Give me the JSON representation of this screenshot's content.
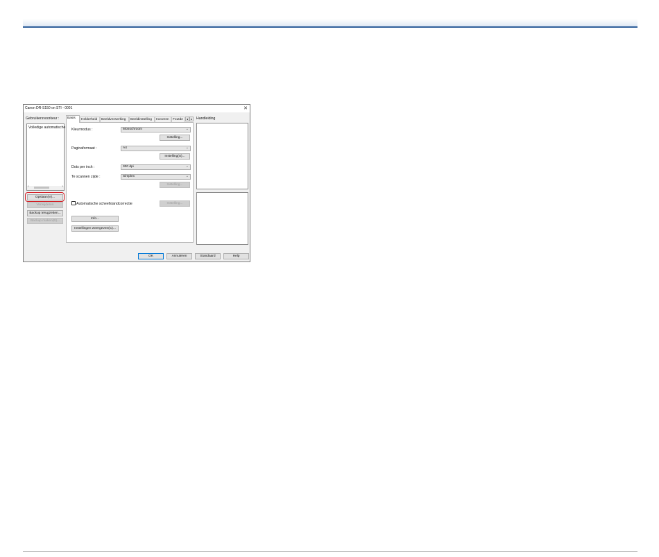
{
  "dialog": {
    "title": "Canon DR-S150 on STI - 0001",
    "close_glyph": "✕"
  },
  "user_settings": {
    "label": "Gebruikersvoorkeur :",
    "items": [
      "Volledige automatische"
    ],
    "buttons": {
      "update": "Opslaan(V)...",
      "delete": "Verwijderen",
      "restore": "Backup terugzetten...",
      "backup": "Backup maken(B)..."
    }
  },
  "tabs": [
    "Basis",
    "Helderheid",
    "Beeldverwerking",
    "Beeldinstelling",
    "Invoeren",
    "Foutde"
  ],
  "tab_arrows": {
    "left": "◂",
    "right": "▸"
  },
  "basic": {
    "color_mode": {
      "label": "Kleurmodus :",
      "value": "Monochroom"
    },
    "color_settings_button": "Instelling...",
    "page_size": {
      "label": "Paginaformaat :",
      "value": "A4"
    },
    "page_settings_button": "Instelling(S)...",
    "dpi": {
      "label": "Dots per inch :",
      "value": "300 dpi"
    },
    "scan_side": {
      "label": "Te scannen zijde :",
      "value": "Simplex"
    },
    "side_settings_button": "Instelling...",
    "deskew": {
      "label": "Automatische scheefstandcorrectie",
      "checked": false
    },
    "deskew_settings_button": "Instelling...",
    "info_button": "Info...",
    "show_settings_button": "Instellingen weergeven(C)..."
  },
  "guide": {
    "label": "Handleiding"
  },
  "footer": {
    "ok": "OK",
    "cancel": "Annuleren",
    "default": "Standaard",
    "help": "Help"
  },
  "icons": {
    "dropdown": "chevron-down-icon",
    "close": "close-icon"
  },
  "colors": {
    "highlight": "#d21f26",
    "header_rule": "#2f5f9a"
  }
}
